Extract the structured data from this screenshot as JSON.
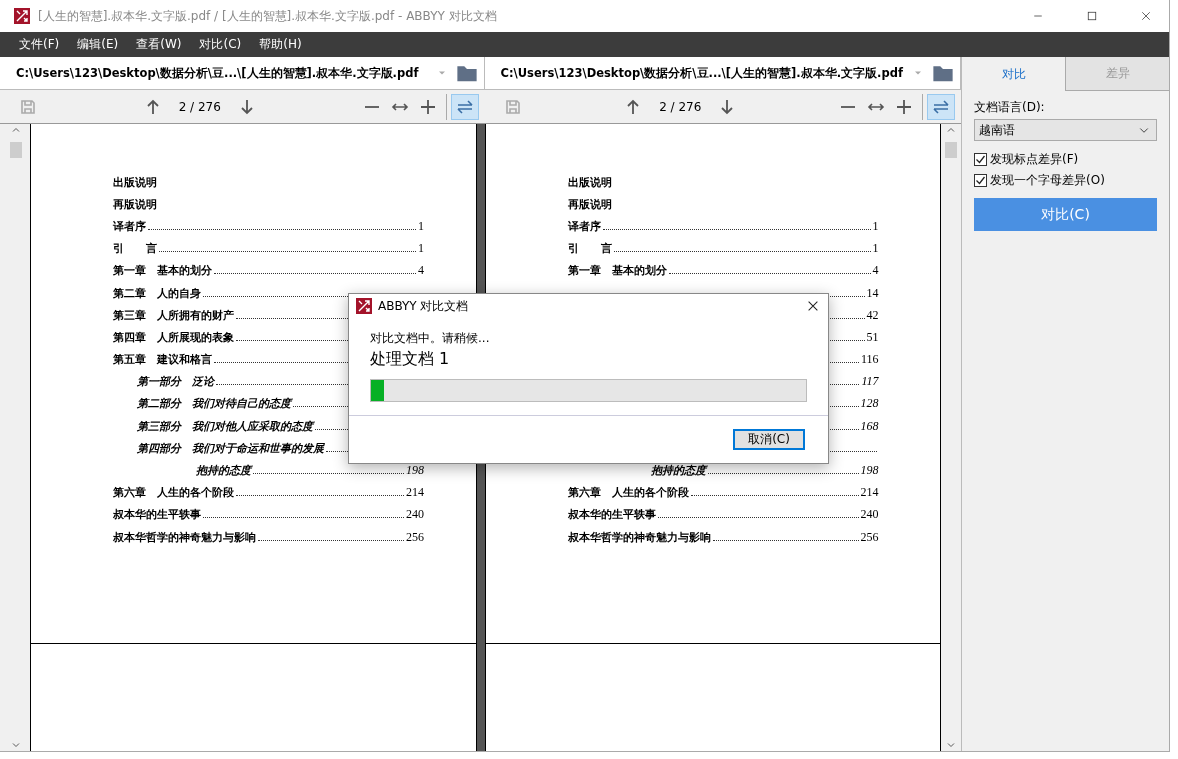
{
  "window": {
    "title": "[人生的智慧].叔本华.文字版.pdf / [人生的智慧].叔本华.文字版.pdf - ABBYY 对比文档"
  },
  "menu": [
    "文件(F)",
    "编辑(E)",
    "查看(W)",
    "对比(C)",
    "帮助(H)"
  ],
  "panes": [
    {
      "path": "C:\\Users\\123\\Desktop\\数据分析\\豆...\\[人生的智慧].叔本华.文字版.pdf",
      "page_indicator": "2 / 276",
      "sync_selected": true,
      "toc": [
        {
          "kind": "heading",
          "title": "出版说明"
        },
        {
          "kind": "heading",
          "title": "再版说明"
        },
        {
          "kind": "chapter",
          "title": "译者序",
          "page": "1"
        },
        {
          "kind": "chapter",
          "title": "引　　言",
          "page": "1"
        },
        {
          "kind": "chapter",
          "title": "第一章　基本的划分",
          "page": "4"
        },
        {
          "kind": "chapter",
          "title": "第二章　人的自身"
        },
        {
          "kind": "chapter",
          "title": "第三章　人所拥有的财产"
        },
        {
          "kind": "chapter",
          "title": "第四章　人所展现的表象"
        },
        {
          "kind": "chapter",
          "title": "第五章　建议和格言"
        },
        {
          "kind": "part",
          "title": "第一部分　泛论"
        },
        {
          "kind": "part",
          "title": "第二部分　我们对待自己的态度"
        },
        {
          "kind": "part",
          "title": "第三部分　我们对他人应采取的态度"
        },
        {
          "kind": "part",
          "title": "第四部分　我们对于命运和世事的发展"
        },
        {
          "kind": "continuation",
          "title": "抱持的态度",
          "page": "198"
        },
        {
          "kind": "chapter",
          "title": "第六章　人生的各个阶段",
          "page": "214"
        },
        {
          "kind": "chapter",
          "title": "叔本华的生平轶事",
          "page": "240"
        },
        {
          "kind": "chapter",
          "title": "叔本华哲学的神奇魅力与影响",
          "page": "256"
        }
      ]
    },
    {
      "path": "C:\\Users\\123\\Desktop\\数据分析\\豆...\\[人生的智慧].叔本华.文字版.pdf",
      "page_indicator": "2 / 276",
      "sync_selected": true,
      "toc": [
        {
          "kind": "heading",
          "title": "出版说明"
        },
        {
          "kind": "heading",
          "title": "再版说明"
        },
        {
          "kind": "chapter",
          "title": "译者序",
          "page": "1"
        },
        {
          "kind": "chapter",
          "title": "引　　言",
          "page": "1"
        },
        {
          "kind": "chapter",
          "title": "第一章　基本的划分",
          "page": "4"
        },
        {
          "kind": "chapter",
          "page": "14"
        },
        {
          "kind": "chapter",
          "page": "42"
        },
        {
          "kind": "chapter",
          "page": "51"
        },
        {
          "kind": "chapter",
          "page": "116"
        },
        {
          "kind": "part",
          "page": "117"
        },
        {
          "kind": "part",
          "page": "128"
        },
        {
          "kind": "part",
          "page": "168"
        },
        {
          "kind": "part"
        },
        {
          "kind": "continuation",
          "title": "抱持的态度",
          "page": "198"
        },
        {
          "kind": "chapter",
          "title": "第六章　人生的各个阶段",
          "page": "214"
        },
        {
          "kind": "chapter",
          "title": "叔本华的生平轶事",
          "page": "240"
        },
        {
          "kind": "chapter",
          "title": "叔本华哲学的神奇魅力与影响",
          "page": "256"
        }
      ]
    }
  ],
  "panel": {
    "tabs": [
      {
        "label": "对比",
        "selected": true
      },
      {
        "label": "差异",
        "selected": false
      }
    ],
    "language_label": "文档语言(D):",
    "language": "越南语",
    "options": [
      {
        "label": "发现标点差异(F)",
        "checked": true
      },
      {
        "label": "发现一个字母差异(O)",
        "checked": true
      }
    ],
    "compare_button": "对比(C)"
  },
  "dialog": {
    "title": "ABBYY 对比文档",
    "message": "对比文档中。请稍候...",
    "status": "处理文档 1",
    "level": 0.03,
    "cancel_button": "取消(C)"
  }
}
